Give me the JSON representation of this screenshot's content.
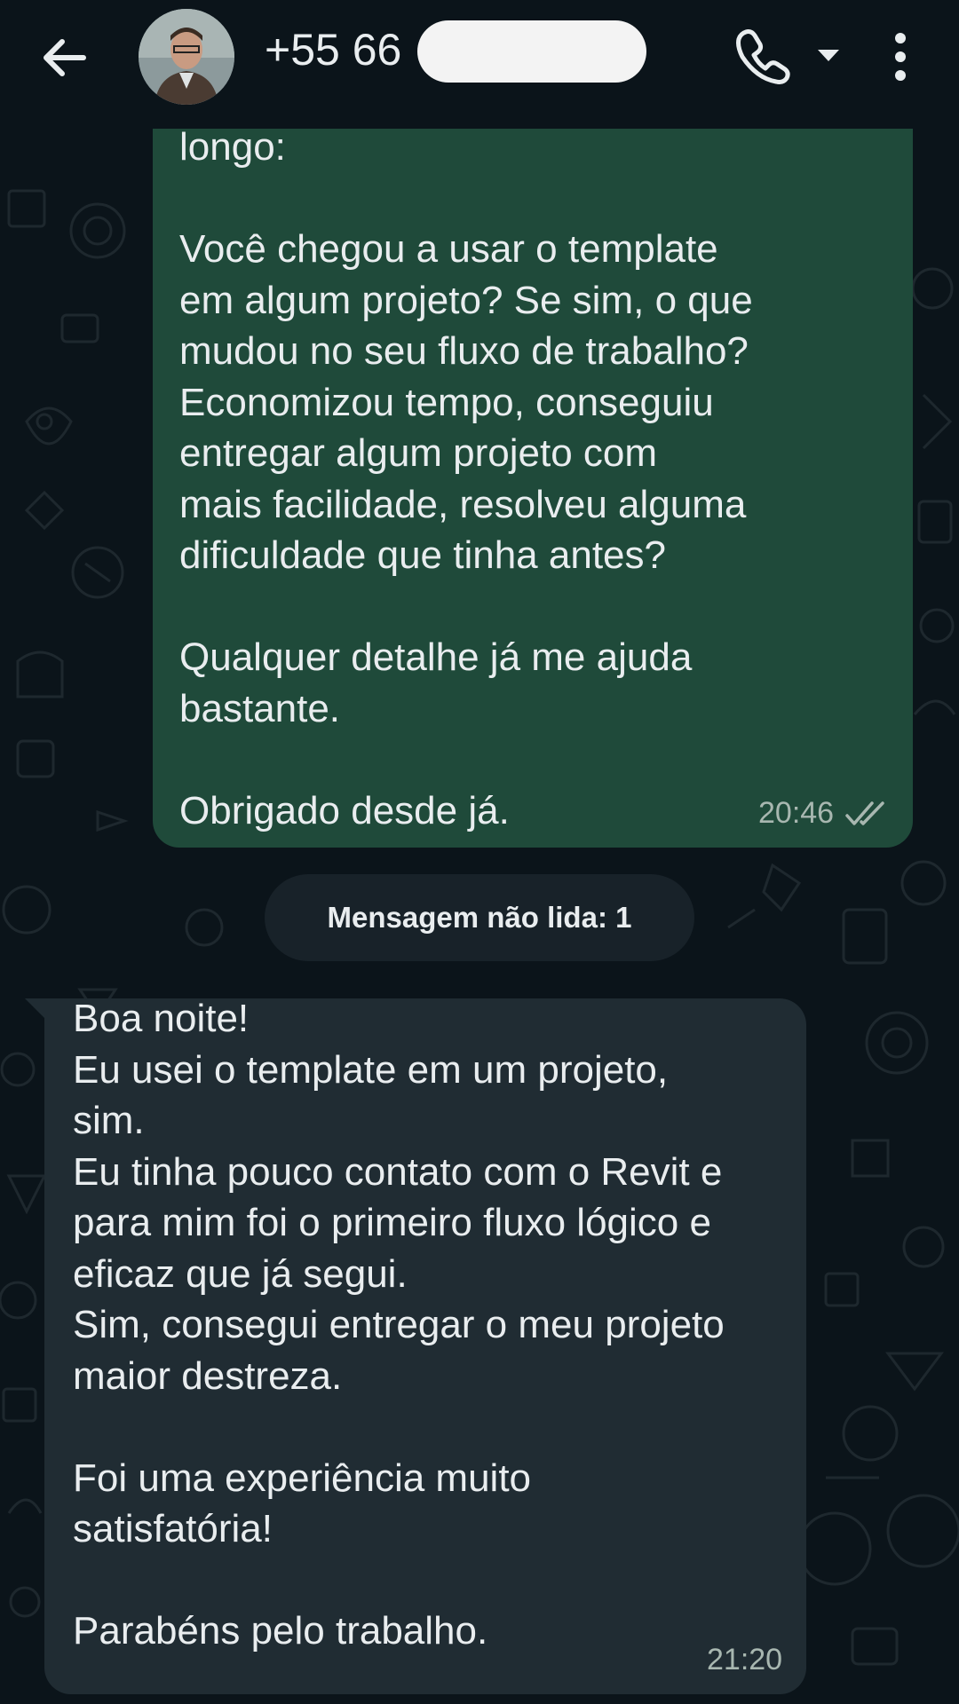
{
  "header": {
    "contact_number": "+55 66",
    "icons": [
      "back-arrow-icon",
      "avatar",
      "phone-call-icon",
      "dropdown-caret-icon",
      "more-vertical-icon"
    ]
  },
  "messages": [
    {
      "direction": "outgoing",
      "text": "longo:\n\nVocê chegou a usar o template\nem algum projeto? Se sim, o que\nmudou no seu fluxo de trabalho?\nEconomizou tempo, conseguiu\nentregar algum projeto com\nmais facilidade, resolveu alguma\ndificuldade que tinha antes?\n\nQualquer detalhe já me ajuda\nbastante.\n\nObrigado desde já.",
      "time": "20:46",
      "status": "read"
    },
    {
      "direction": "incoming",
      "text": "Boa noite!\nEu usei o template em um projeto,\nsim.\nEu tinha pouco contato com o Revit e\npara mim foi o primeiro fluxo lógico e\neficaz que já segui.\nSim, consegui entregar o meu projeto\nmaior destreza.\n\nFoi uma experiência muito\nsatisfatória!\n\nParabéns pelo trabalho.",
      "time": "21:20"
    }
  ],
  "unread_divider": "Mensagem não lida: 1",
  "colors": {
    "background": "#0b141a",
    "outgoing_bubble": "#1f4a3a",
    "incoming_bubble": "#202c33",
    "text": "#e9edef"
  }
}
